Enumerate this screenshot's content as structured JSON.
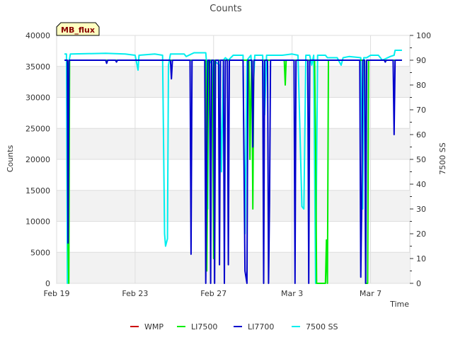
{
  "chart_data": {
    "type": "line",
    "title": "Counts",
    "badge": "MB_flux",
    "xlabel": "Time",
    "ylabel": "Counts",
    "y2label": "7500 SS",
    "x_ticks": [
      {
        "day": 0,
        "label": "Feb 19"
      },
      {
        "day": 4,
        "label": "Feb 23"
      },
      {
        "day": 8,
        "label": "Feb 27"
      },
      {
        "day": 12,
        "label": "Mar 3"
      },
      {
        "day": 16,
        "label": "Mar 7"
      }
    ],
    "xlim": [
      0,
      18
    ],
    "ylim": [
      0,
      40000
    ],
    "y_ticks": [
      0,
      5000,
      10000,
      15000,
      20000,
      25000,
      30000,
      35000,
      40000
    ],
    "y2lim": [
      0,
      100
    ],
    "y2_ticks": [
      0,
      10,
      20,
      30,
      40,
      50,
      60,
      70,
      80,
      90,
      100
    ],
    "legend_position": "bottom",
    "series": [
      {
        "name": "WMP",
        "color": "#cc0000",
        "axis": "left",
        "points": []
      },
      {
        "name": "LI7500",
        "color": "#00ee00",
        "axis": "left",
        "points": [
          [
            0.45,
            36000
          ],
          [
            0.55,
            36000
          ],
          [
            0.58,
            6300
          ],
          [
            0.62,
            0
          ],
          [
            0.66,
            36000
          ],
          [
            7.6,
            36000
          ],
          [
            7.65,
            2000
          ],
          [
            7.75,
            36000
          ],
          [
            7.9,
            36000
          ],
          [
            7.95,
            30000
          ],
          [
            8.0,
            4000
          ],
          [
            8.05,
            36000
          ],
          [
            9.8,
            36000
          ],
          [
            9.85,
            20000
          ],
          [
            9.9,
            31000
          ],
          [
            9.95,
            36000
          ],
          [
            10.0,
            12000
          ],
          [
            10.05,
            36000
          ],
          [
            11.6,
            36000
          ],
          [
            11.65,
            32000
          ],
          [
            11.7,
            36000
          ],
          [
            13.15,
            36000
          ],
          [
            13.2,
            22000
          ],
          [
            13.25,
            0
          ],
          [
            13.7,
            0
          ],
          [
            13.75,
            7000
          ],
          [
            13.8,
            0
          ],
          [
            13.85,
            36000
          ],
          [
            15.7,
            36000
          ],
          [
            15.75,
            0
          ],
          [
            15.85,
            0
          ],
          [
            15.9,
            36000
          ],
          [
            17.6,
            36000
          ]
        ]
      },
      {
        "name": "LI7700",
        "color": "#0000cc",
        "axis": "left",
        "points": [
          [
            0.4,
            36000
          ],
          [
            0.55,
            36000
          ],
          [
            0.58,
            6500
          ],
          [
            0.63,
            36000
          ],
          [
            2.5,
            36000
          ],
          [
            2.55,
            35500
          ],
          [
            2.6,
            36000
          ],
          [
            3.0,
            36000
          ],
          [
            3.05,
            35700
          ],
          [
            3.1,
            36000
          ],
          [
            5.8,
            36000
          ],
          [
            5.85,
            33000
          ],
          [
            5.9,
            36000
          ],
          [
            6.8,
            36000
          ],
          [
            6.85,
            4700
          ],
          [
            6.9,
            36000
          ],
          [
            7.55,
            36000
          ],
          [
            7.6,
            0
          ],
          [
            7.65,
            22000
          ],
          [
            7.7,
            36000
          ],
          [
            7.8,
            36000
          ],
          [
            7.85,
            0
          ],
          [
            7.9,
            36000
          ],
          [
            8.0,
            36000
          ],
          [
            8.05,
            0
          ],
          [
            8.1,
            36000
          ],
          [
            8.25,
            36000
          ],
          [
            8.3,
            3000
          ],
          [
            8.35,
            36000
          ],
          [
            8.5,
            36000
          ],
          [
            8.55,
            0
          ],
          [
            8.6,
            36000
          ],
          [
            8.7,
            36000
          ],
          [
            8.75,
            3000
          ],
          [
            8.8,
            36000
          ],
          [
            9.5,
            36000
          ],
          [
            9.6,
            2000
          ],
          [
            9.7,
            0
          ],
          [
            9.75,
            36000
          ],
          [
            9.95,
            36000
          ],
          [
            10.0,
            22000
          ],
          [
            10.05,
            36000
          ],
          [
            10.5,
            36000
          ],
          [
            10.55,
            0
          ],
          [
            10.6,
            36000
          ],
          [
            10.75,
            36000
          ],
          [
            10.8,
            0
          ],
          [
            10.85,
            13000
          ],
          [
            10.9,
            36000
          ],
          [
            12.1,
            36000
          ],
          [
            12.15,
            0
          ],
          [
            12.2,
            36000
          ],
          [
            12.8,
            36000
          ],
          [
            12.85,
            0
          ],
          [
            12.9,
            36000
          ],
          [
            15.45,
            36000
          ],
          [
            15.5,
            1000
          ],
          [
            15.55,
            12800
          ],
          [
            15.6,
            36000
          ],
          [
            15.7,
            36000
          ],
          [
            15.75,
            0
          ],
          [
            15.8,
            36000
          ],
          [
            16.7,
            36000
          ],
          [
            16.75,
            35700
          ],
          [
            16.8,
            36000
          ],
          [
            17.15,
            36000
          ],
          [
            17.2,
            24000
          ],
          [
            17.25,
            36000
          ],
          [
            17.6,
            36000
          ]
        ]
      },
      {
        "name": "7500 SS",
        "color": "#00eeee",
        "axis": "right",
        "points": [
          [
            0.4,
            92.5
          ],
          [
            0.5,
            92.5
          ],
          [
            0.55,
            0
          ],
          [
            0.6,
            88
          ],
          [
            0.7,
            92.5
          ],
          [
            2.5,
            92.8
          ],
          [
            3.5,
            92.5
          ],
          [
            4.0,
            92.0
          ],
          [
            4.1,
            88
          ],
          [
            4.15,
            86
          ],
          [
            4.2,
            92
          ],
          [
            5.0,
            92.5
          ],
          [
            5.4,
            92
          ],
          [
            5.5,
            20
          ],
          [
            5.55,
            15
          ],
          [
            5.65,
            18
          ],
          [
            5.7,
            88
          ],
          [
            5.8,
            92.5
          ],
          [
            6.5,
            92.5
          ],
          [
            6.6,
            91.5
          ],
          [
            7.0,
            93
          ],
          [
            7.6,
            93
          ],
          [
            7.65,
            88
          ],
          [
            7.7,
            30
          ],
          [
            7.75,
            88
          ],
          [
            7.9,
            90
          ],
          [
            7.95,
            75
          ],
          [
            8.0,
            90
          ],
          [
            8.3,
            88
          ],
          [
            8.4,
            45
          ],
          [
            8.5,
            90
          ],
          [
            8.6,
            91
          ],
          [
            8.75,
            90
          ],
          [
            9.0,
            92
          ],
          [
            9.5,
            92
          ],
          [
            9.6,
            20
          ],
          [
            9.7,
            90
          ],
          [
            9.9,
            92
          ],
          [
            10.0,
            75
          ],
          [
            10.1,
            92
          ],
          [
            10.5,
            92
          ],
          [
            10.6,
            68
          ],
          [
            10.7,
            92
          ],
          [
            11.0,
            92
          ],
          [
            11.5,
            92
          ],
          [
            12.0,
            92.5
          ],
          [
            12.3,
            92
          ],
          [
            12.5,
            31
          ],
          [
            12.6,
            30
          ],
          [
            12.7,
            92
          ],
          [
            12.9,
            92
          ],
          [
            13.0,
            88
          ],
          [
            13.1,
            92
          ],
          [
            13.2,
            0
          ],
          [
            13.3,
            92
          ],
          [
            13.7,
            92
          ],
          [
            13.8,
            91
          ],
          [
            14.3,
            91
          ],
          [
            14.5,
            88
          ],
          [
            14.6,
            91
          ],
          [
            14.9,
            91.5
          ],
          [
            15.5,
            91
          ],
          [
            15.6,
            30
          ],
          [
            15.65,
            91
          ],
          [
            15.8,
            91
          ],
          [
            16.0,
            92
          ],
          [
            16.4,
            92
          ],
          [
            16.6,
            90
          ],
          [
            17.0,
            91.5
          ],
          [
            17.2,
            92
          ],
          [
            17.25,
            94
          ],
          [
            17.6,
            94
          ]
        ]
      }
    ]
  }
}
